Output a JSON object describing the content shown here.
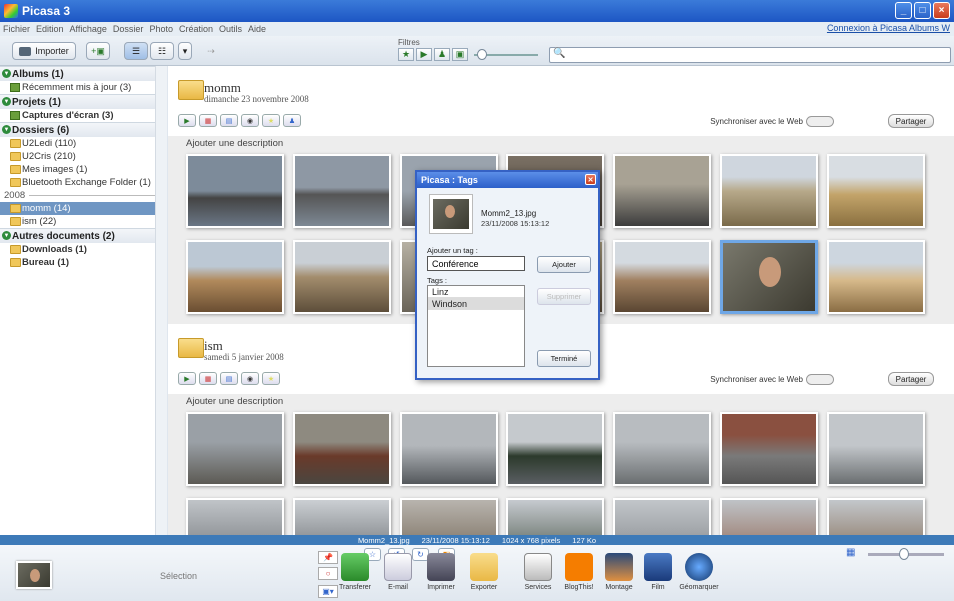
{
  "app": {
    "title": "Picasa 3"
  },
  "menu": [
    "Fichier",
    "Edition",
    "Affichage",
    "Dossier",
    "Photo",
    "Création",
    "Outils",
    "Aide"
  ],
  "connect_link": "Connexion à Picasa Albums W",
  "toolbar": {
    "import_label": "Importer",
    "filters_label": "Filtres"
  },
  "sidebar": {
    "sections": [
      {
        "label": "Albums (1)",
        "items": [
          {
            "label": "Récemment mis à jour (3)",
            "kind": "album"
          }
        ]
      },
      {
        "label": "Projets (1)",
        "items": [
          {
            "label": "Captures d'écran (3)",
            "kind": "album",
            "bold": true
          }
        ]
      },
      {
        "label": "Dossiers (6)",
        "items": [
          {
            "label": "U2Ledi (110)",
            "kind": "folder"
          },
          {
            "label": "U2Cris (210)",
            "kind": "folder"
          },
          {
            "label": "Mes images (1)",
            "kind": "folder"
          },
          {
            "label": "Bluetooth Exchange Folder (1)",
            "kind": "folder"
          }
        ]
      },
      {
        "label": "Autres documents (2)",
        "items": [
          {
            "label": "Downloads (1)",
            "kind": "folder",
            "bold": true
          },
          {
            "label": "Bureau (1)",
            "kind": "folder",
            "bold": true
          }
        ]
      }
    ],
    "year": "2008",
    "year_items": [
      {
        "label": "momm (14)",
        "selected": true
      },
      {
        "label": "ism (22)",
        "selected": false
      }
    ]
  },
  "albums": [
    {
      "name": "momm",
      "date": "dimanche 23 novembre 2008",
      "sync_label": "Synchroniser avec le Web",
      "share_label": "Partager",
      "description": "Ajouter une description"
    },
    {
      "name": "ism",
      "date": "samedi 5 janvier 2008",
      "sync_label": "Synchroniser avec le Web",
      "share_label": "Partager",
      "description": "Ajouter une description"
    }
  ],
  "dialog": {
    "title": "Picasa : Tags",
    "filename": "Momm2_13.jpg",
    "datetime": "23/11/2008 15:13:12",
    "add_tag_label": "Ajouter un tag :",
    "tag_value": "Conférence",
    "add_button": "Ajouter",
    "tags_label": "Tags :",
    "tags": [
      "Linz",
      "Windson"
    ],
    "remove_button": "Supprimer",
    "done_button": "Terminé"
  },
  "status": {
    "file": "Momm2_13.jpg",
    "datetime": "23/11/2008 15:13:12",
    "dimensions": "1024 x 768 pixels",
    "size": "127 Ko"
  },
  "tray": {
    "selection_label": "Sélection",
    "actions": [
      "Transferer",
      "E-mail",
      "Imprimer",
      "Exporter",
      "Services",
      "BlogThis!",
      "Montage",
      "Film",
      "Géomarquer"
    ]
  },
  "colors": {
    "titlebar": "#1d56c4",
    "selected": "#6f96c3",
    "status": "#3d7ab8"
  }
}
